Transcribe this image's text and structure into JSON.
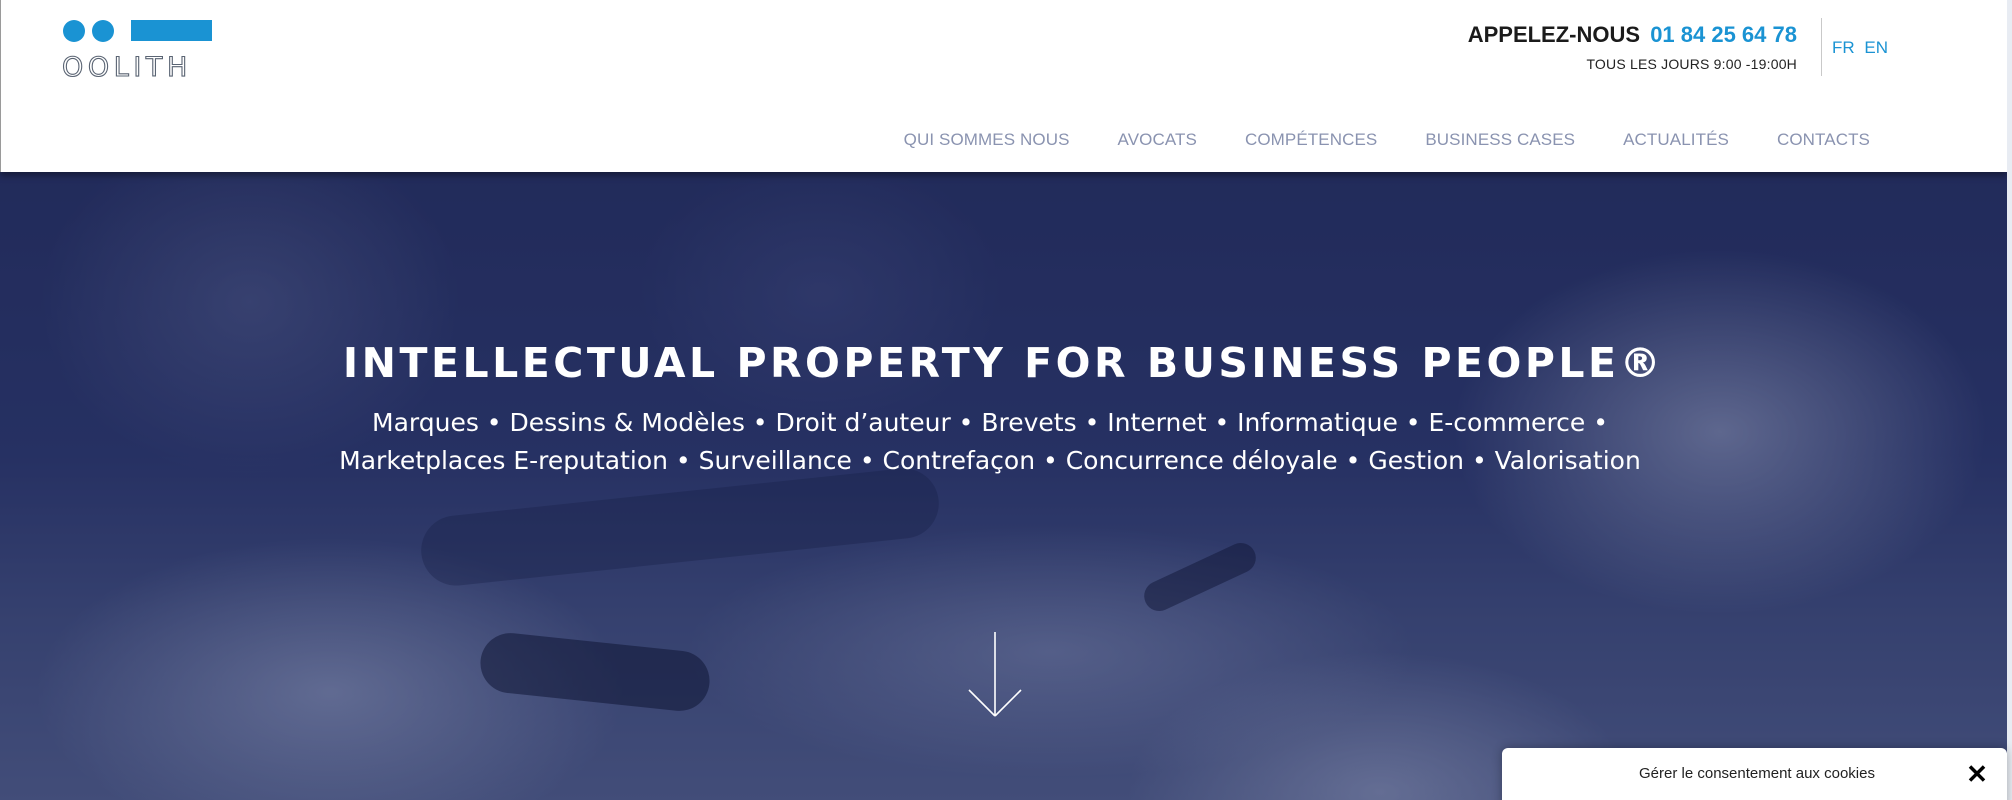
{
  "header": {
    "logo_text": "OOLITH",
    "call_label": "APPELEZ-NOUS",
    "phone": "01 84 25 64 78",
    "hours": "TOUS LES JOURS 9:00 -19:00H",
    "languages": [
      "FR",
      "EN"
    ],
    "nav": [
      "QUI SOMMES NOUS",
      "AVOCATS",
      "COMPÉTENCES",
      "BUSINESS CASES",
      "ACTUALITÉS",
      "CONTACTS"
    ]
  },
  "hero": {
    "title": "INTELLECTUAL PROPERTY FOR BUSINESS PEOPLE®",
    "tags": "Marques • Dessins & Modèles • Droit d’auteur • Brevets • Internet • Informatique • E-commerce • Marketplaces E-reputation • Surveillance • Contrefaçon • Concurrence déloyale • Gestion • Valorisation",
    "arrow_icon": "arrow-down-icon"
  },
  "cookie": {
    "title": "Gérer le consentement aux cookies",
    "close_icon": "close-icon",
    "close_glyph": "✕"
  },
  "colors": {
    "brand_blue": "#1a93d3",
    "nav_text": "#8a93b0",
    "hero_overlay": "#1f2b5c"
  }
}
